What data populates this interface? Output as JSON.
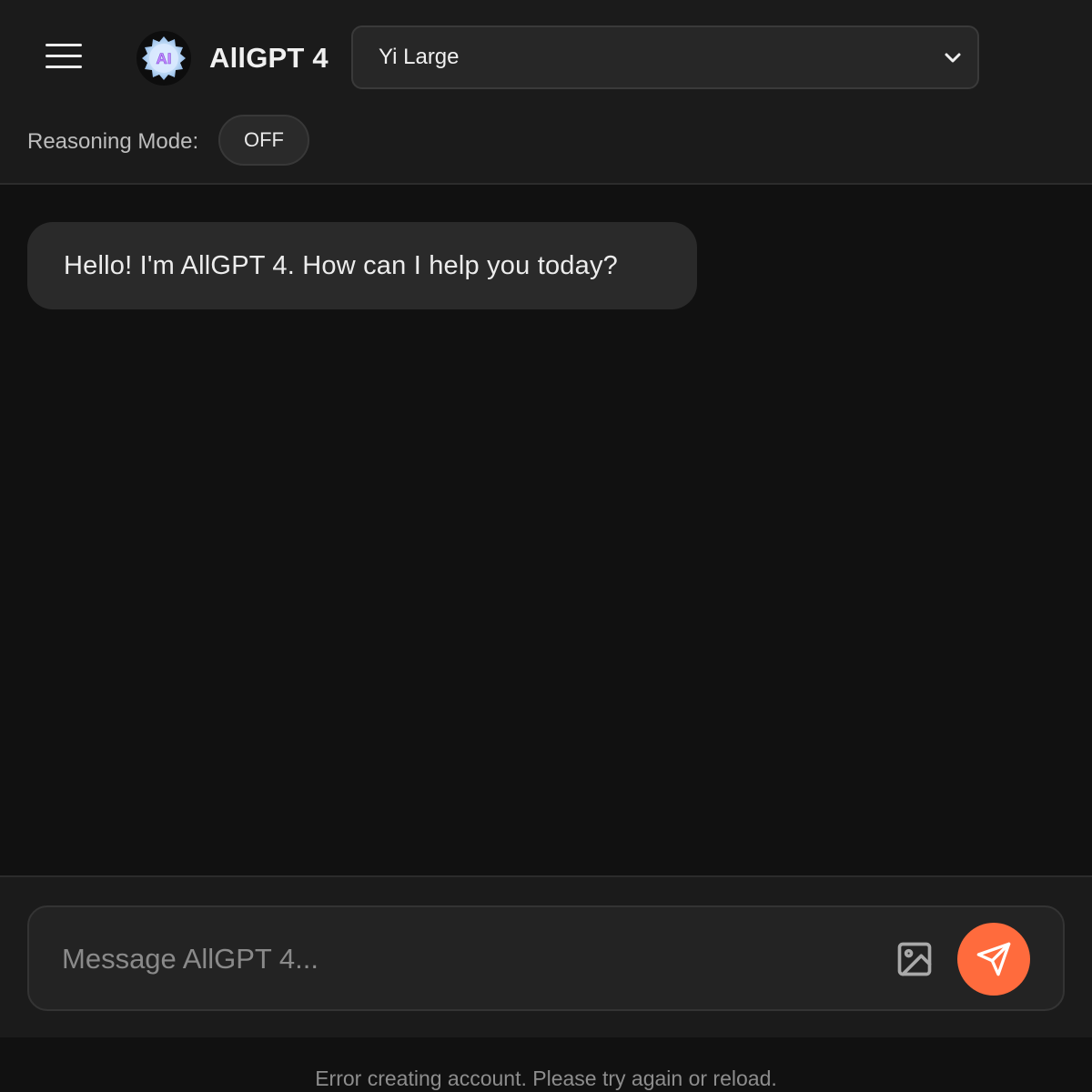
{
  "header": {
    "menu_icon": "hamburger-menu-icon",
    "logo_text": "AI",
    "app_title": "AllGPT 4",
    "model_select": {
      "selected": "Yi Large",
      "icon": "chevron-down-icon"
    },
    "reasoning": {
      "label": "Reasoning Mode:",
      "toggle_label": "OFF"
    }
  },
  "chat": {
    "messages": [
      {
        "role": "assistant",
        "text": "Hello! I'm AllGPT 4. How can I help you today?"
      }
    ]
  },
  "composer": {
    "placeholder": "Message AllGPT 4...",
    "value": "",
    "image_icon": "image-icon",
    "send_icon": "send-icon"
  },
  "status": {
    "error": "Error creating account. Please try again or reload."
  },
  "colors": {
    "accent": "#ff6b3d",
    "background": "#111111",
    "panel": "#1b1b1b"
  }
}
